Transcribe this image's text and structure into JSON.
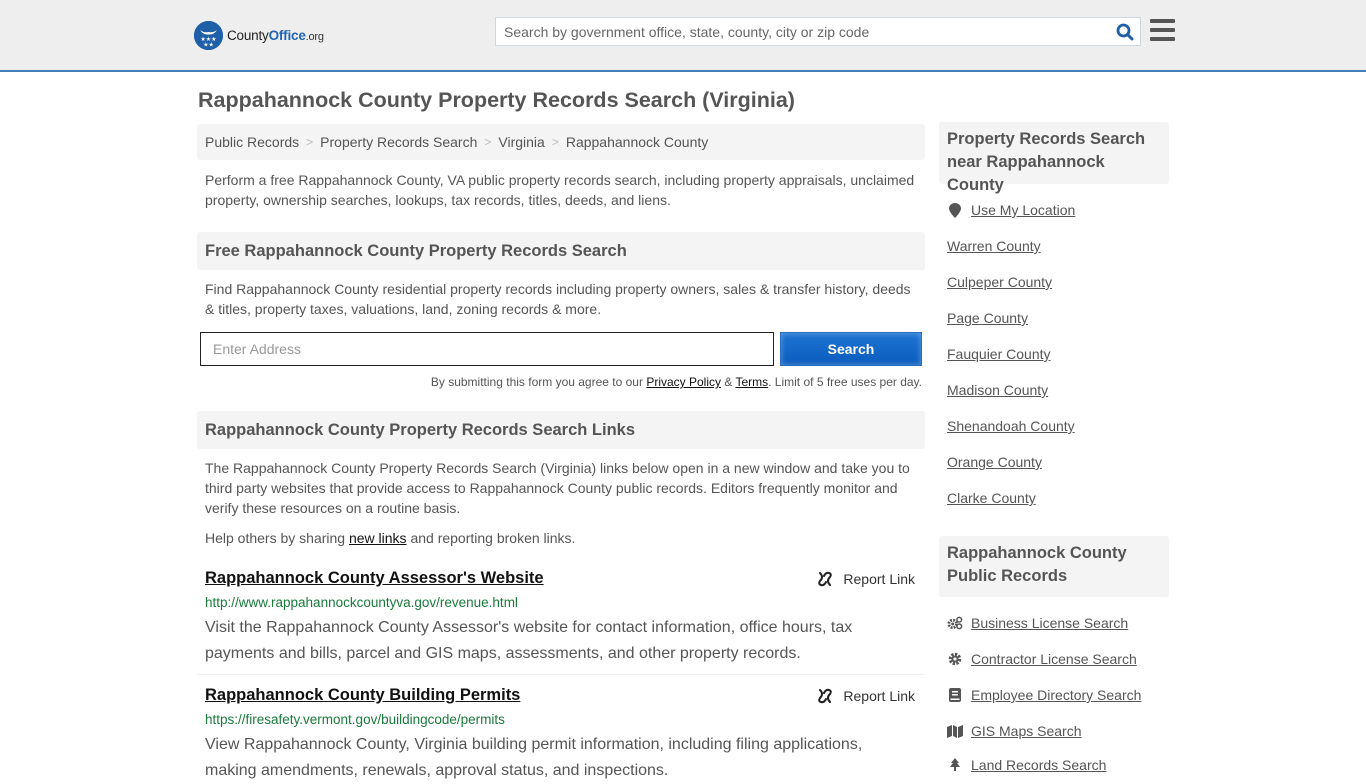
{
  "header": {
    "logo": {
      "county": "County",
      "office": "Office",
      "org": ".org"
    },
    "search_placeholder": "Search by government office, state, county, city or zip code"
  },
  "page_title": "Rappahannock County Property Records Search (Virginia)",
  "breadcrumb": [
    {
      "label": "Public Records"
    },
    {
      "label": "Property Records Search"
    },
    {
      "label": "Virginia"
    },
    {
      "label": "Rappahannock County"
    }
  ],
  "breadcrumb_separator": ">",
  "intro": "Perform a free Rappahannock County, VA public property records search, including property appraisals, unclaimed property, ownership searches, lookups, tax records, titles, deeds, and liens.",
  "free_search": {
    "heading": "Free Rappahannock County Property Records Search",
    "description": "Find Rappahannock County residential property records including property owners, sales & transfer history, deeds & titles, property taxes, valuations, land, zoning records & more.",
    "input_placeholder": "Enter Address",
    "button_label": "Search",
    "disclaimer_pre": "By submitting this form you agree to our ",
    "privacy_label": "Privacy Policy",
    "amp": " & ",
    "terms_label": "Terms",
    "disclaimer_post": ". Limit of 5 free uses per day."
  },
  "links_section": {
    "heading": "Rappahannock County Property Records Search Links",
    "description": "The Rappahannock County Property Records Search (Virginia) links below open in a new window and take you to third party websites that provide access to Rappahannock County public records. Editors frequently monitor and verify these resources on a routine basis.",
    "help_pre": "Help others by sharing ",
    "help_link": "new links",
    "help_post": " and reporting broken links.",
    "report_label": "Report Link",
    "items": [
      {
        "title": "Rappahannock County Assessor's Website",
        "url": "http://www.rappahannockcountyva.gov/revenue.html",
        "description": "Visit the Rappahannock County Assessor's website for contact information, office hours, tax payments and bills, parcel and GIS maps, assessments, and other property records."
      },
      {
        "title": "Rappahannock County Building Permits",
        "url": "https://firesafety.vermont.gov/buildingcode/permits",
        "description": "View Rappahannock County, Virginia building permit information, including filing applications, making amendments, renewals, approval status, and inspections."
      }
    ]
  },
  "sidebar": {
    "nearby_heading": "Property Records Search near Rappahannock County",
    "use_location": "Use My Location",
    "nearby": [
      "Warren County",
      "Culpeper County",
      "Page County",
      "Fauquier County",
      "Madison County",
      "Shenandoah County",
      "Orange County",
      "Clarke County"
    ],
    "public_records_heading": "Rappahannock County Public Records",
    "public_records": [
      {
        "label": "Business License Search",
        "icon": "gears-icon"
      },
      {
        "label": "Contractor License Search",
        "icon": "gear-icon"
      },
      {
        "label": "Employee Directory Search",
        "icon": "book-icon"
      },
      {
        "label": "GIS Maps Search",
        "icon": "map-icon"
      },
      {
        "label": "Land Records Search",
        "icon": "tree-icon"
      }
    ]
  },
  "colors": {
    "accent_blue": "#1f66b3",
    "header_border": "#3f7fb5",
    "url_green": "#1a7a3c",
    "button_blue": "#0a5cbd"
  }
}
